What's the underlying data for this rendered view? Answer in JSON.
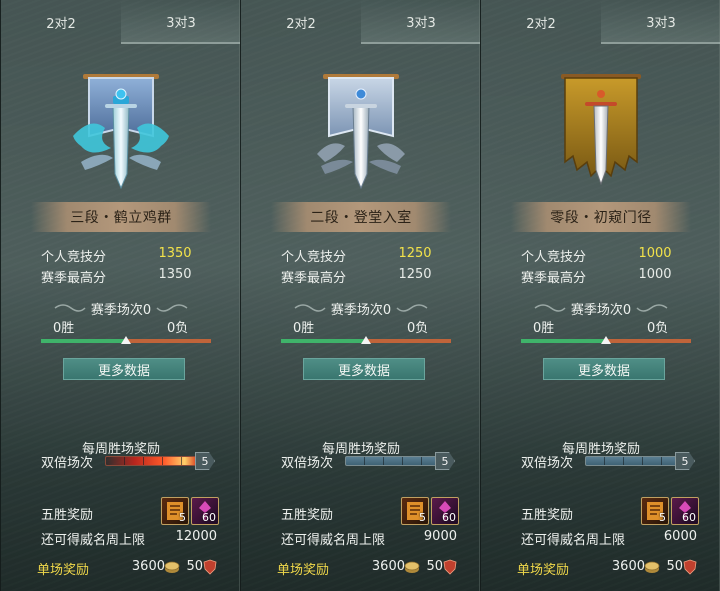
{
  "colors": {
    "gold_value": "#f2e24a",
    "single_reward_label": "#f0d84a",
    "win_bar": "#3fb36a",
    "lose_bar": "#c0643a",
    "button": "#3f7d75"
  },
  "panels": [
    {
      "tabs": [
        "2对2",
        "3对3"
      ],
      "active_tab": 1,
      "emblem": "blue-dragon-sword-banner-icon",
      "rank_name": "三段・鹤立鸡群",
      "personal_score_label": "个人竞技分",
      "personal_score": "1350",
      "season_high_label": "赛季最高分",
      "season_high": "1350",
      "season_matches": "赛季场次0",
      "wins": "0胜",
      "losses": "0负",
      "more_button": "更多数据",
      "weekly_title": "每周胜场奖励",
      "double_label": "双倍场次",
      "weekly_progress": "5",
      "five_win_label": "五胜奖励",
      "item1_count": "5",
      "item2_count": "60",
      "cap_label": "还可得威名周上限",
      "cap_value": "12000",
      "single_label": "单场奖励",
      "single_coins": "3600",
      "single_shields": "50"
    },
    {
      "tabs": [
        "2对2",
        "3对3"
      ],
      "active_tab": 1,
      "emblem": "silver-sword-banner-icon",
      "rank_name": "二段・登堂入室",
      "personal_score_label": "个人竞技分",
      "personal_score": "1250",
      "season_high_label": "赛季最高分",
      "season_high": "1250",
      "season_matches": "赛季场次0",
      "wins": "0胜",
      "losses": "0负",
      "more_button": "更多数据",
      "weekly_title": "每周胜场奖励",
      "double_label": "双倍场次",
      "weekly_progress": "5",
      "five_win_label": "五胜奖励",
      "item1_count": "5",
      "item2_count": "60",
      "cap_label": "还可得威名周上限",
      "cap_value": "9000",
      "single_label": "单场奖励",
      "single_coins": "3600",
      "single_shields": "50"
    },
    {
      "tabs": [
        "2对2",
        "3对3"
      ],
      "active_tab": 1,
      "emblem": "tattered-gold-sword-banner-icon",
      "rank_name": "零段・初窥门径",
      "personal_score_label": "个人竞技分",
      "personal_score": "1000",
      "season_high_label": "赛季最高分",
      "season_high": "1000",
      "season_matches": "赛季场次0",
      "wins": "0胜",
      "losses": "0负",
      "more_button": "更多数据",
      "weekly_title": "每周胜场奖励",
      "double_label": "双倍场次",
      "weekly_progress": "5",
      "five_win_label": "五胜奖励",
      "item1_count": "5",
      "item2_count": "60",
      "cap_label": "还可得威名周上限",
      "cap_value": "6000",
      "single_label": "单场奖励",
      "single_coins": "3600",
      "single_shields": "50"
    }
  ]
}
